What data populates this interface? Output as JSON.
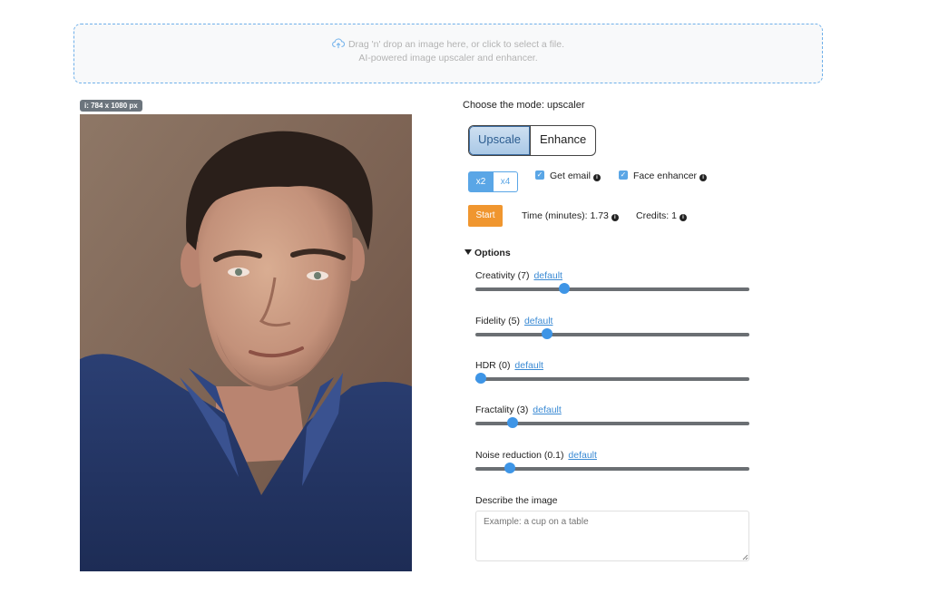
{
  "dropzone": {
    "line1": "Drag 'n' drop an image here, or click to select a file.",
    "line2": "AI-powered image upscaler and enhancer.",
    "icon": "cloud-upload-icon"
  },
  "image_badge": "i: 784 x 1080 px",
  "mode": {
    "title": "Choose the mode: upscaler",
    "options": [
      "Upscale",
      "Enhance"
    ],
    "selected": "Upscale"
  },
  "scale": {
    "options": [
      "x2",
      "x4"
    ],
    "selected": "x2"
  },
  "checkboxes": {
    "email": {
      "label": "Get email",
      "checked": true
    },
    "face": {
      "label": "Face enhancer",
      "checked": true
    }
  },
  "actions": {
    "start_label": "Start",
    "time_label": "Time (minutes): 1.73",
    "credits_label": "Credits: 1"
  },
  "options": {
    "title": "Options",
    "default_link": "default",
    "sliders": [
      {
        "label": "Creativity (7)",
        "value": 7,
        "min": 0,
        "max": 22
      },
      {
        "label": "Fidelity (5)",
        "value": 5,
        "min": 0,
        "max": 20
      },
      {
        "label": "HDR (0)",
        "value": 0,
        "min": 0,
        "max": 50
      },
      {
        "label": "Fractality (3)",
        "value": 3,
        "min": 0,
        "max": 25
      },
      {
        "label": "Noise reduction (0.1)",
        "value": 0.1,
        "min": 0,
        "max": 0.9
      }
    ]
  },
  "describe": {
    "label": "Describe the image",
    "placeholder": "Example: a cup on a table"
  },
  "colors": {
    "accent": "#5aa6e6",
    "start": "#f0962f",
    "slider_thumb": "#3e95e6"
  }
}
